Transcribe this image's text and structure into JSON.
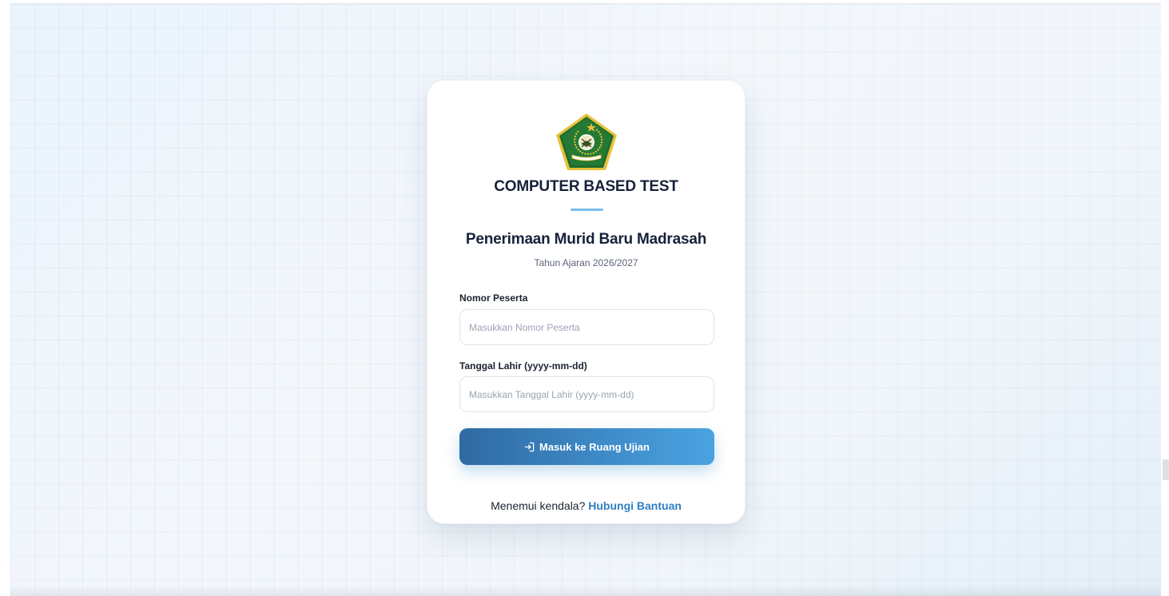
{
  "app": {
    "title": "COMPUTER BASED TEST",
    "heading": "Penerimaan Murid Baru Madrasah",
    "academic_year": "Tahun Ajaran 2026/2027",
    "logo": "kemenag-emblem",
    "logo_text": "IKHLAS BERAMAL"
  },
  "form": {
    "participant_number": {
      "label": "Nomor Peserta",
      "placeholder": "Masukkan Nomor Peserta",
      "value": ""
    },
    "birth_date": {
      "label": "Tanggal Lahir (yyyy-mm-dd)",
      "placeholder": "Masukkan Tanggal Lahir (yyyy-mm-dd)",
      "value": ""
    },
    "submit": {
      "label": "Masuk ke Ruang Ujian",
      "icon": "login-icon"
    }
  },
  "help": {
    "prompt": "Menemui kendala?",
    "link_label": "Hubungi Bantuan"
  },
  "colors": {
    "accent": "#3f8dca",
    "accent_dark": "#2f6aa3",
    "link": "#2f7fc1",
    "title": "#16213a",
    "emblem_green": "#1f6b2e",
    "emblem_gold": "#e8c23a"
  }
}
